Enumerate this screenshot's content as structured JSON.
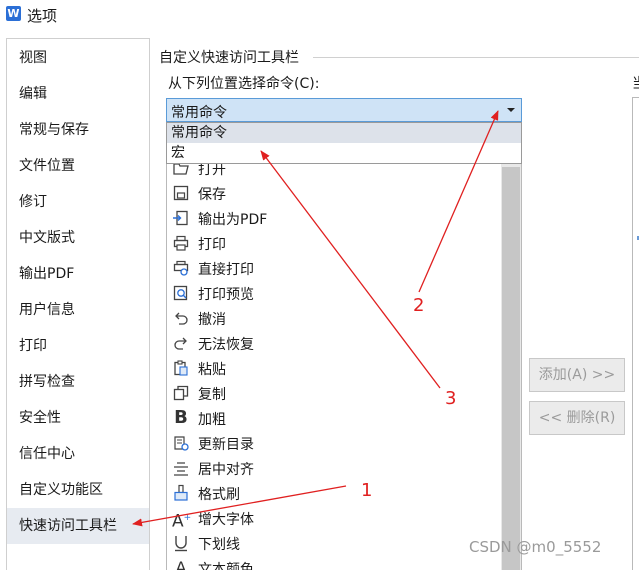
{
  "window": {
    "title": "选项",
    "app_icon_letter": "W"
  },
  "sidebar": {
    "items": [
      {
        "label": "视图"
      },
      {
        "label": "编辑"
      },
      {
        "label": "常规与保存"
      },
      {
        "label": "文件位置"
      },
      {
        "label": "修订"
      },
      {
        "label": "中文版式"
      },
      {
        "label": "输出PDF"
      },
      {
        "label": "用户信息"
      },
      {
        "label": "打印"
      },
      {
        "label": "拼写检查"
      },
      {
        "label": "安全性"
      },
      {
        "label": "信任中心"
      },
      {
        "label": "自定义功能区"
      },
      {
        "label": "快速访问工具栏",
        "active": true
      }
    ]
  },
  "main": {
    "section_title": "自定义快速访问工具栏",
    "choose_label": "从下列位置选择命令(C):",
    "combo_value": "常用命令",
    "dropdown_options": [
      "常用命令",
      "宏"
    ],
    "commands": [
      {
        "label": "打开",
        "icon": "folder-open-icon"
      },
      {
        "label": "保存",
        "icon": "save-icon"
      },
      {
        "label": "输出为PDF",
        "icon": "export-pdf-icon"
      },
      {
        "label": "打印",
        "icon": "print-icon"
      },
      {
        "label": "直接打印",
        "icon": "direct-print-icon"
      },
      {
        "label": "打印预览",
        "icon": "print-preview-icon"
      },
      {
        "label": "撤消",
        "icon": "undo-icon"
      },
      {
        "label": "无法恢复",
        "icon": "redo-icon"
      },
      {
        "label": "粘贴",
        "icon": "paste-icon"
      },
      {
        "label": "复制",
        "icon": "copy-icon"
      },
      {
        "label": "加粗",
        "icon": "bold-icon"
      },
      {
        "label": "更新目录",
        "icon": "update-toc-icon"
      },
      {
        "label": "居中对齐",
        "icon": "align-center-icon"
      },
      {
        "label": "格式刷",
        "icon": "format-painter-icon"
      },
      {
        "label": "增大字体",
        "icon": "increase-font-icon"
      },
      {
        "label": "下划线",
        "icon": "underline-icon"
      },
      {
        "label": "文本颜色",
        "icon": "text-color-icon"
      }
    ],
    "add_button": "添加(A) >>",
    "remove_button": "<< 删除(R)",
    "right_label": "当"
  },
  "annotations": [
    {
      "label": "1",
      "color": "#e02020"
    },
    {
      "label": "2",
      "color": "#e02020"
    },
    {
      "label": "3",
      "color": "#e02020"
    }
  ],
  "watermark": "CSDN @m0_5552"
}
